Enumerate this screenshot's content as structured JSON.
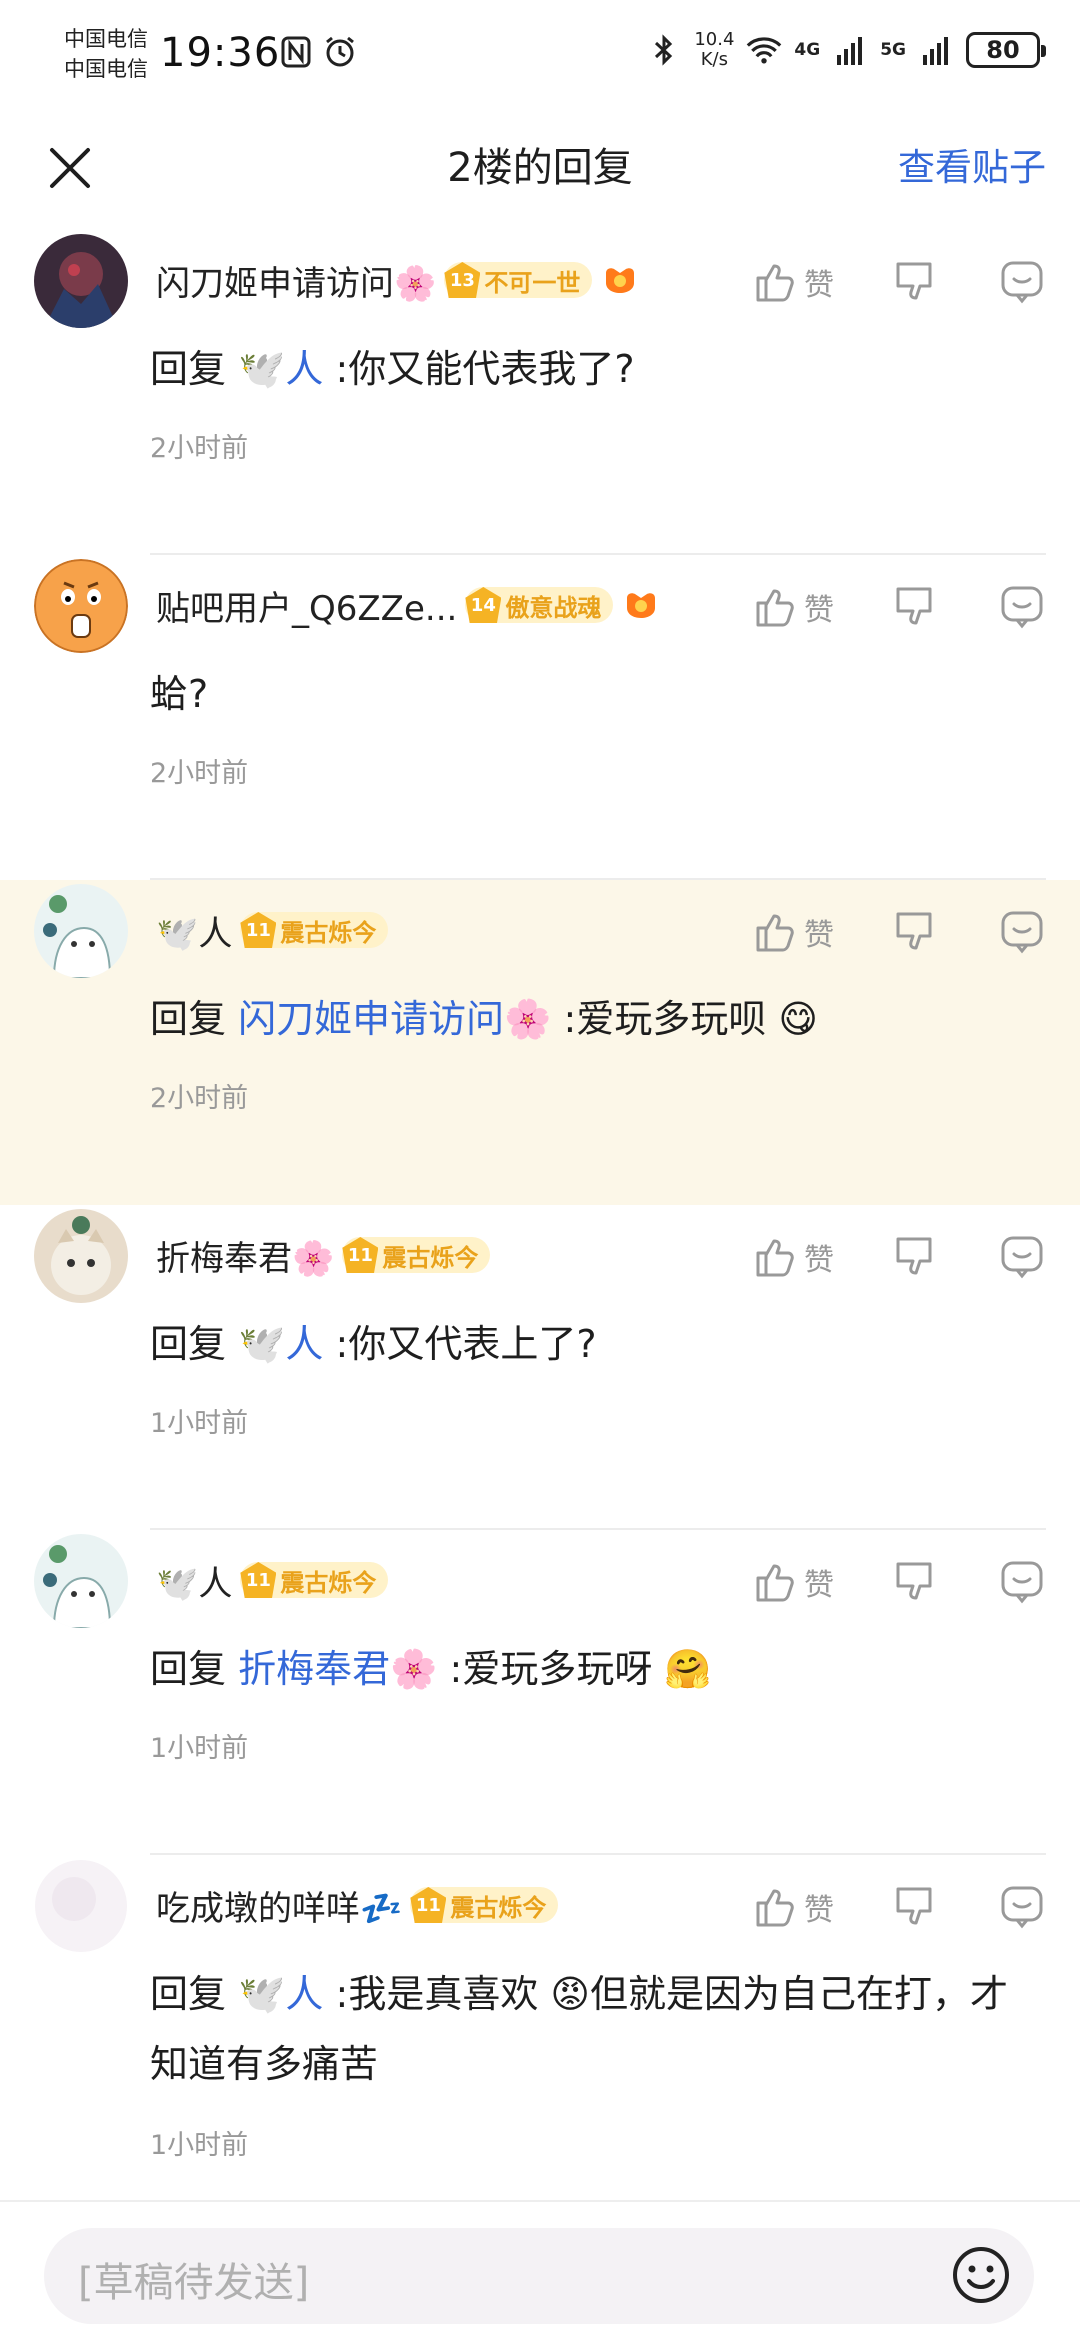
{
  "status_bar": {
    "carrier_1": "中国电信",
    "carrier_2": "中国电信",
    "time": "19:36",
    "net_speed_value": "10.4",
    "net_speed_unit": "K/s",
    "network_1": "4G",
    "network_2": "5G",
    "battery": "80"
  },
  "header": {
    "title": "2楼的回复",
    "view_post": "查看贴子"
  },
  "like_label": "赞",
  "replies": [
    {
      "username": "闪刀姬申请访问🌸",
      "level": "13",
      "level_title": "不可一世",
      "reply_word": "回复",
      "mention": "🕊️人",
      "text": " :你又能代表我了?",
      "time": "2小时前"
    },
    {
      "username": "贴吧用户_Q6ZZe...",
      "level": "14",
      "level_title": "傲意战魂",
      "text": "蛤?",
      "time": "2小时前"
    },
    {
      "username": "🕊️人",
      "level": "11",
      "level_title": "震古烁今",
      "reply_word": "回复",
      "mention": "闪刀姬申请访问🌸",
      "text": " :爱玩多玩呗 😋",
      "time": "2小时前"
    },
    {
      "username": "折梅奉君🌸",
      "level": "11",
      "level_title": "震古烁今",
      "reply_word": "回复",
      "mention": "🕊️人",
      "text": " :你又代表上了?",
      "time": "1小时前"
    },
    {
      "username": "🕊️人",
      "level": "11",
      "level_title": "震古烁今",
      "reply_word": "回复",
      "mention": "折梅奉君🌸",
      "text": " :爱玩多玩呀 🤗",
      "time": "1小时前"
    },
    {
      "username": "吃成墩的咩咩💤",
      "level": "11",
      "level_title": "震古烁今",
      "reply_word": "回复",
      "mention": "🕊️人",
      "text": " :我是真喜欢 😡但就是因为自己在打，才知道有多痛苦",
      "time": "1小时前"
    }
  ],
  "input": {
    "placeholder": "[草稿待发送]"
  },
  "colors": {
    "accent": "#3468d8",
    "highlight_bg": "#fcf7e8",
    "badge_gold": "#f5b324"
  }
}
